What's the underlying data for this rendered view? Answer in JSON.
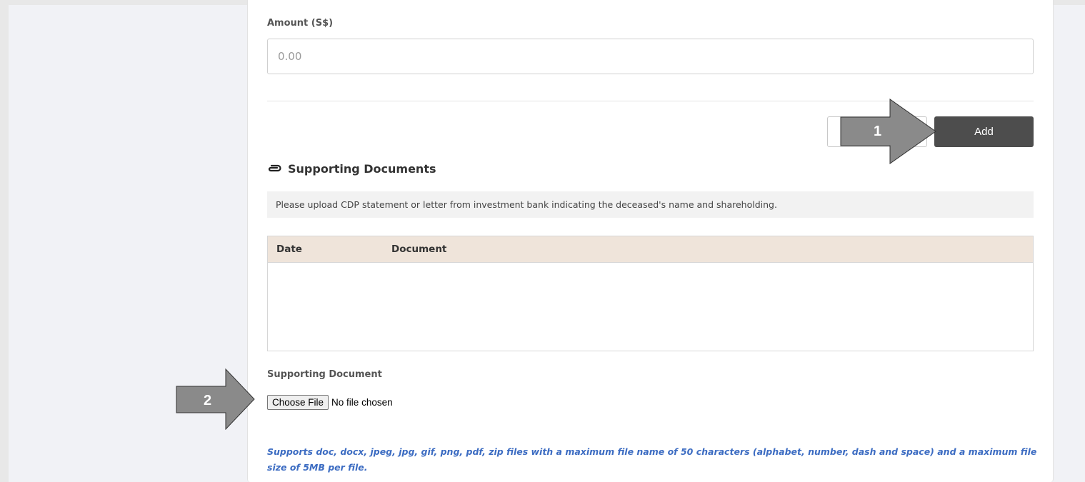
{
  "form": {
    "amount_label": "Amount (S$)",
    "amount_placeholder": "0.00",
    "cancel_label": "",
    "add_label": "Add"
  },
  "supporting_docs": {
    "section_title": "Supporting Documents",
    "section_icon": "paperclip-icon",
    "instruction": "Please upload CDP statement or letter from investment bank indicating the deceased's name and shareholding.",
    "table_headers": [
      "Date",
      "Document"
    ],
    "rows": [],
    "field_label": "Supporting Document",
    "choose_file_label": "Choose File",
    "no_file_text": "No file chosen",
    "note": "Supports doc, docx, jpeg, jpg, gif, png, pdf, zip files with a maximum file name of 50 characters (alphabet, number, dash and space) and a maximum file size of 5MB per file."
  },
  "callouts": [
    {
      "number": "1",
      "icon": "arrow-right-icon"
    },
    {
      "number": "2",
      "icon": "arrow-right-icon"
    }
  ],
  "colors": {
    "add_button": "#4d4d4d",
    "table_header": "#efe4da",
    "note_text": "#3c6cc2",
    "callout_arrow": "#8a8a8a"
  }
}
